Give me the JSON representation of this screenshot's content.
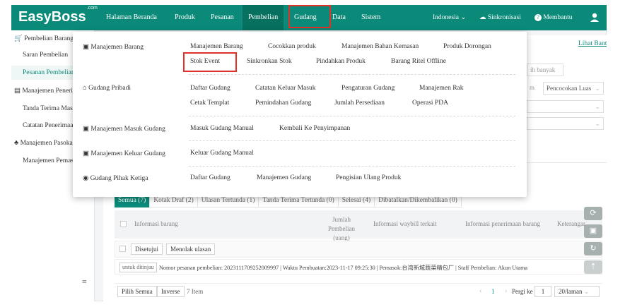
{
  "topbar": {
    "logo": "EasyBoss",
    "logo_sup": ".com",
    "nav": [
      "Halaman Beranda",
      "Produk",
      "Pesanan",
      "Pembelian",
      "Gudang",
      "Data",
      "Sistem"
    ],
    "active_nav": "Pembelian",
    "highlighted_nav": "Gudang",
    "language": "Indonesia",
    "sync": "Sinkronisasi",
    "help": "Membantu"
  },
  "sidebar": {
    "items": [
      {
        "label": "Pembelian Barang",
        "icon": "shopping-icon",
        "group": true
      },
      {
        "label": "Saran Pembelian"
      },
      {
        "label": "Pesanan Pembelian",
        "active": true
      },
      {
        "label": "Manajemen Peneri...",
        "icon": "receipt-icon",
        "group": true
      },
      {
        "label": "Tanda Terima Masuk"
      },
      {
        "label": "Catatan Penerimaan"
      },
      {
        "label": "Manajemen Pasokan",
        "icon": "supplier-icon",
        "group": true
      },
      {
        "label": "Manajemen Pemasok"
      }
    ],
    "collapse_icon": "menu-icon"
  },
  "dropdown": {
    "sections": [
      {
        "heading": "Manajemen Barang",
        "icon": "box-icon",
        "rows": [
          [
            "Manajemen Barang",
            "Cocokkan produk",
            "Manajemen Bahan Kemasan",
            "Produk Dorongan"
          ],
          [
            "Stok Event",
            "Sinkronkan Stok",
            "Pindahkan Produk",
            "Barang Ritel Offline"
          ]
        ]
      },
      {
        "heading": "Gudang Pribadi",
        "icon": "home-icon",
        "rows": [
          [
            "Daftar Gudang",
            "Catatan Keluar Masuk",
            "Pengaturan Gudang",
            "Manajemen Rak"
          ],
          [
            "Cetak Templat",
            "Pemindahan Gudang",
            "Jumlah Persediaan",
            "Operasi PDA"
          ]
        ]
      },
      {
        "heading": "Manajemen Masuk Gudang",
        "icon": "warehouse-in-icon",
        "rows": [
          [
            "Masuk Gudang Manual",
            "Kembali Ke Penyimpanan"
          ]
        ]
      },
      {
        "heading": "Manajemen Keluar Gudang",
        "icon": "warehouse-out-icon",
        "rows": [
          [
            "Keluar Gudang Manual"
          ]
        ]
      },
      {
        "heading": "Gudang Pihak Ketiga",
        "icon": "globe-icon",
        "rows": [
          [
            "Daftar Gudang",
            "Manajemen Gudang",
            "Pengisian Ulang Produk"
          ]
        ]
      }
    ],
    "highlighted_item": "Stok Event"
  },
  "content": {
    "link": "Lihat Bantuan",
    "input_placeholder": "ih banyak",
    "select_label": "Pencocokan Luas",
    "select_prefix": "m"
  },
  "tabs": [
    {
      "label": "Semua (7)",
      "selected": true
    },
    {
      "label": "Kotak Draf (2)"
    },
    {
      "label": "Ulasan Tertunda (1)"
    },
    {
      "label": "Tanda Terima Tertunda (0)"
    },
    {
      "label": "Selesai (4)"
    },
    {
      "label": "Dibatalkan/Dikembalikan (0)"
    }
  ],
  "table": {
    "headers": [
      "Informasi barang",
      "Jumlah Pembelian (uang)",
      "Informasi waybill terkait",
      "Informasi penerimaan barang",
      "Keterangan"
    ],
    "actions": [
      "Disetujui",
      "Menolak ulasan"
    ],
    "order_tag": "untuk ditinjau",
    "order_info": "Nomor pesanan pembelian: 2023111709252009997  |  Waktu Pembuatan:2023-11-17 09:25:30  |  Pemasok:台湾新城蔬菜精包厂  |  Staff Pembelian: Akun Utama"
  },
  "footer": {
    "select_all": "Pilih Semua",
    "inverse": "Inverse",
    "count": "7 Item",
    "page": "1",
    "goto_label": "Pergi ke",
    "goto_value": "1",
    "per_page": "20/laman"
  }
}
